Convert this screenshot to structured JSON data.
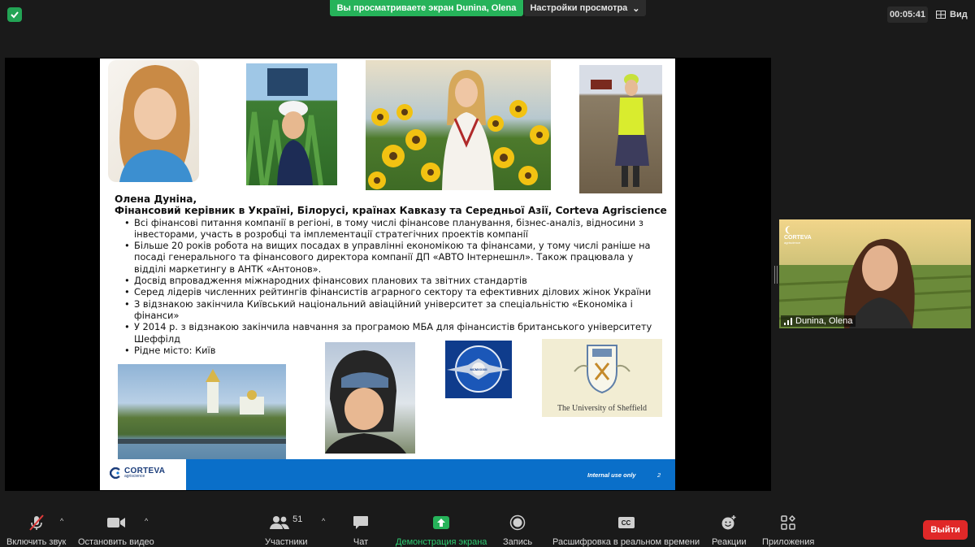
{
  "topbar": {
    "share_banner": "Вы просматриваете экран Dunina, Olena",
    "view_options": "Настройки просмотра",
    "timer": "00:05:41",
    "view_label": "Вид"
  },
  "slide": {
    "name": "Олена Дуніна,",
    "role": "Фінансовий керівник в Україні, Білорусі, країнах Кавказу та Середньої Азії, Corteva Agriscience",
    "bullets": [
      "Всі фінансові питання компанії в регіоні, в тому числі фінансове планування, бізнес-аналіз, відносини з інвесторами, участь в розробці та імплементації стратегічних проектів компанії",
      "Більше 20 років робота на вищих посадах в управлінні економікою та фінансами, у тому числі раніше на посаді генерального та фінансового директора компанії ДП «АВТО Інтернешнл». Також працювала у відділі маркетингу в АНТК «Антонов».",
      "Досвід впровадження міжнародних фінансових планових та звітних стандартів",
      "Серед лідерів численних рейтингів фінансистів аграрного сектору та ефективних ділових жінок України",
      "З відзнакою закінчила Київський національний авіаційний університет за спеціальністю «Економіка і фінанси»",
      "У 2014 р. з відзнакою закінчила навчання за програмою МБА для фінансистів британського університету Шеффілд",
      "Рідне місто: Київ"
    ],
    "sheffield_caption": "The University of Sheffield",
    "nau_badge": "MCMXXXIII",
    "footer_logo": "CORTEVA",
    "footer_logo_sub": "agriscience",
    "internal_label": "Internal use only",
    "page_number": "2"
  },
  "video_tile": {
    "participant_name": "Dunina, Olena",
    "logo": "CORTEVA",
    "logo_sub": "agriscience"
  },
  "toolbar": {
    "mute": "Включить звук",
    "video": "Остановить видео",
    "participants": "Участники",
    "participants_count": "51",
    "chat": "Чат",
    "share": "Демонстрация экрана",
    "record": "Запись",
    "captions": "Расшифровка в реальном времени",
    "captions_icon": "CC",
    "reactions": "Реакции",
    "apps": "Приложения",
    "leave": "Выйти"
  },
  "colors": {
    "share_green": "#26b35a",
    "leave_red": "#e02828",
    "slide_footer_blue": "#0a6fc9"
  }
}
